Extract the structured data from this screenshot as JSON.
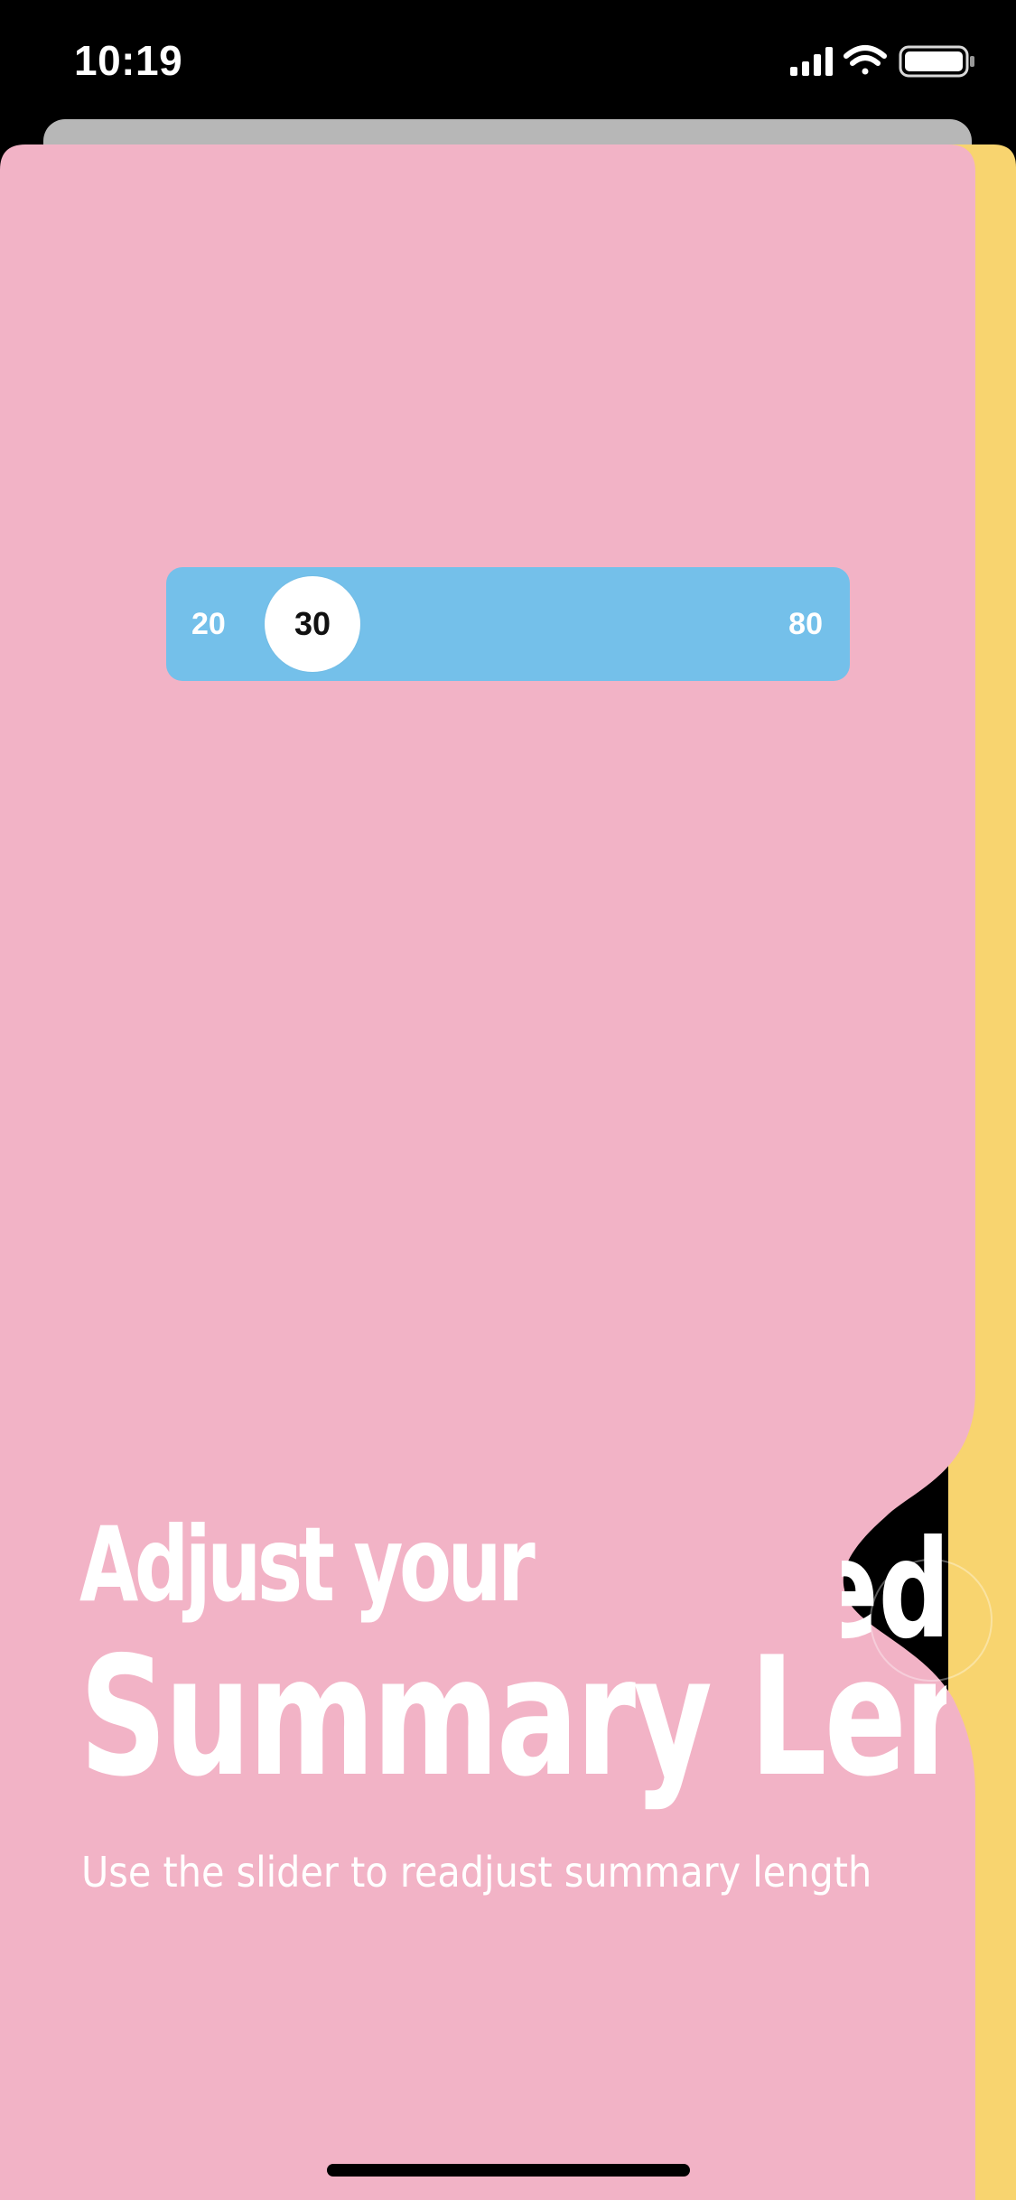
{
  "status_bar": {
    "time": "10:19",
    "icons": [
      "cellular-signal-icon",
      "wifi-icon",
      "battery-icon"
    ]
  },
  "onboarding": {
    "title_line1": "Adjust your",
    "title_line2": "Summary Length",
    "subtitle": "Use the slider to readjust summary length",
    "next_page_peek_text": "ed",
    "next_button_icon": "next-page-circle-icon"
  },
  "slider": {
    "min_label": "20",
    "max_label": "80",
    "min": 20,
    "max": 80,
    "value": 30,
    "value_label": "30"
  },
  "colors": {
    "page_background": "#f2b3c6",
    "next_page_background": "#f8d46f",
    "slider_track": "#74c0ea",
    "slider_thumb": "#ffffff",
    "text": "#ffffff",
    "status_bar": "#000000"
  }
}
